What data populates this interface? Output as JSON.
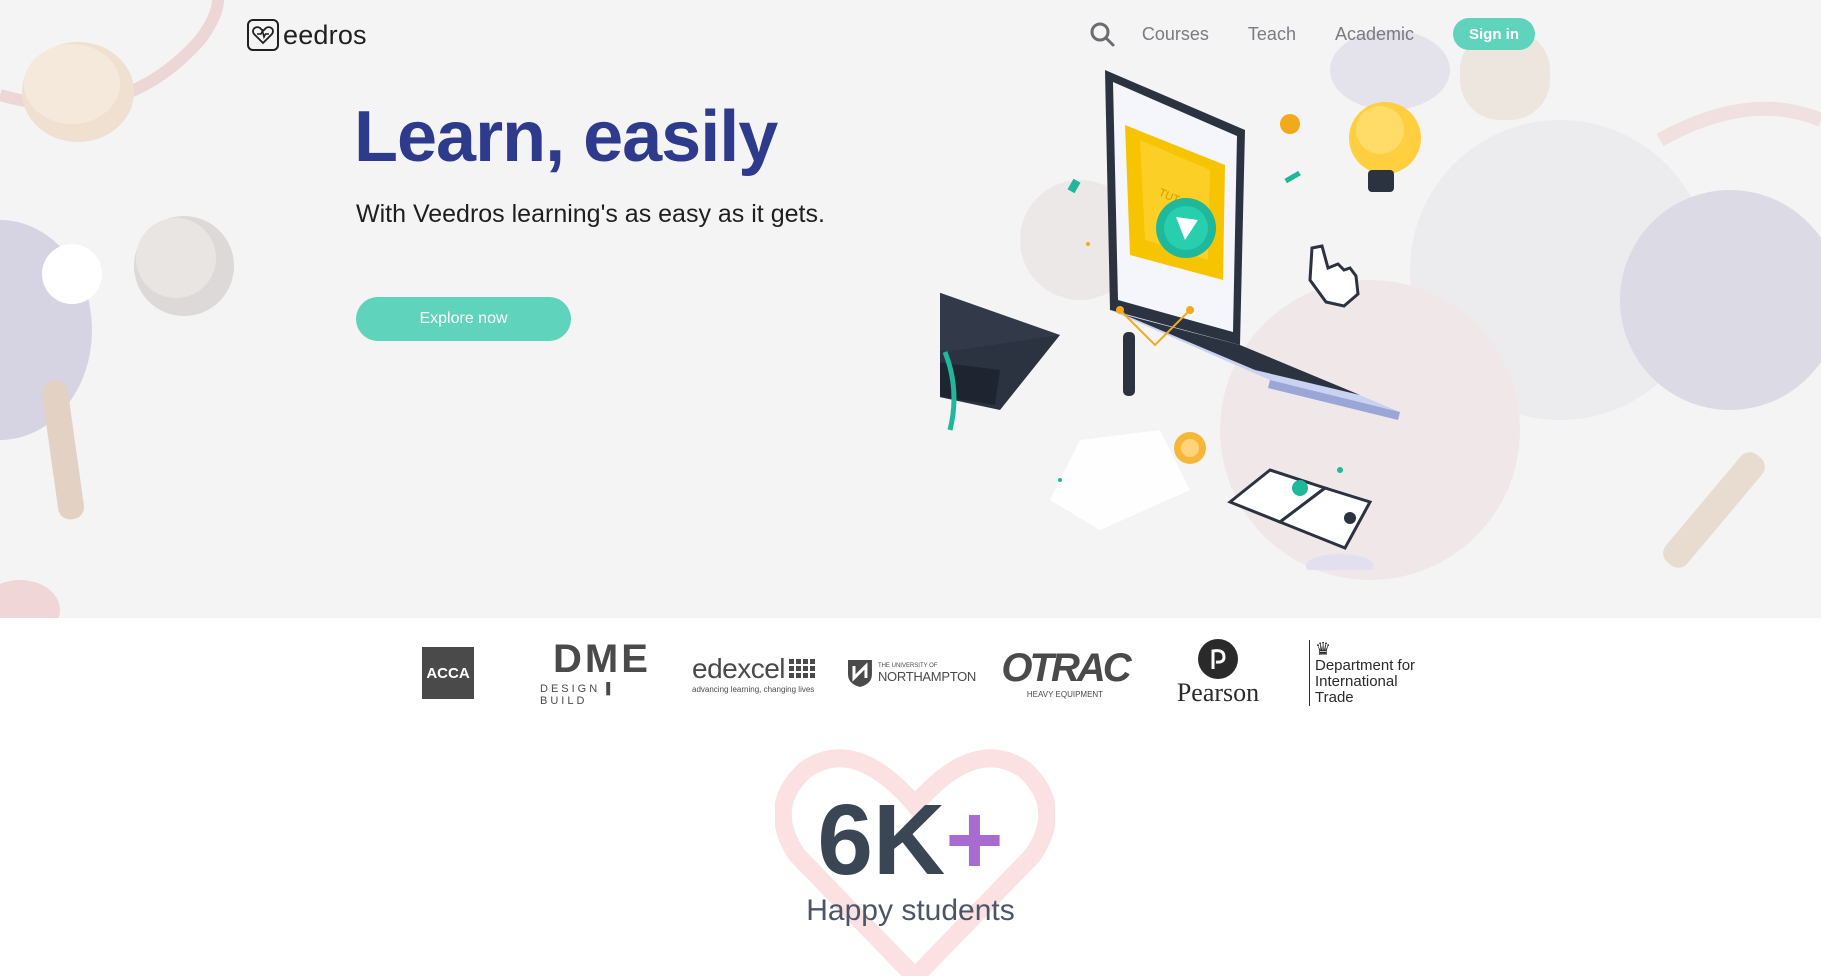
{
  "brand": {
    "name": "eedros"
  },
  "nav": {
    "links": [
      "Courses",
      "Teach",
      "Academic"
    ],
    "signin_label": "Sign in"
  },
  "hero": {
    "headline": "Learn, easily",
    "subline": "With Veedros learning's as easy as it gets.",
    "cta_label": "Explore now",
    "illustration_text": "TUTORIAL"
  },
  "partners": {
    "acca": "ACCA",
    "dme_main": "DME",
    "dme_sub": "DESIGN ▌ BUILD",
    "edexcel_main": "edexcel",
    "edexcel_sub": "advancing learning, changing lives",
    "northampton_top": "THE UNIVERSITY OF",
    "northampton_main": "NORTHAMPTON",
    "otrac_main": "OTRAC",
    "otrac_sub": "HEAVY EQUIPMENT",
    "pearson": "Pearson",
    "dit_line1": "Department for",
    "dit_line2": "International Trade"
  },
  "stats": {
    "number": "6K",
    "plus": "+",
    "label": "Happy students"
  },
  "colors": {
    "accent": "#5fd3bb",
    "headline": "#2e3a8c",
    "plus": "#a86bd0"
  }
}
